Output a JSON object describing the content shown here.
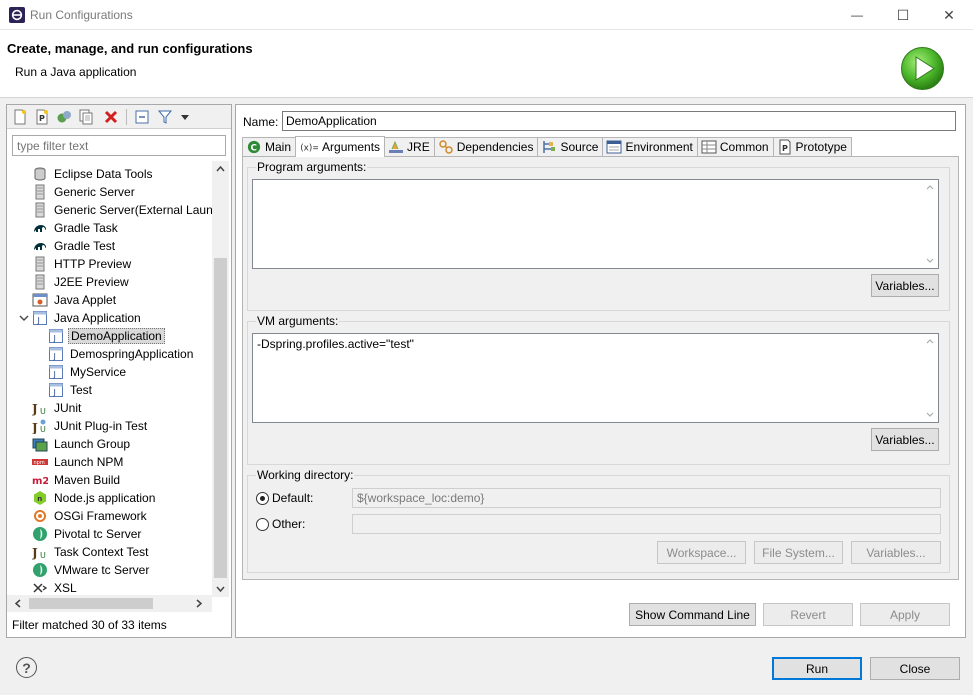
{
  "window": {
    "title": "Run Configurations",
    "controls": {
      "minimize": "—",
      "maximize": "☐",
      "close": "✕"
    }
  },
  "header": {
    "title": "Create, manage, and run configurations",
    "subtitle": "Run a Java application"
  },
  "left": {
    "filter_placeholder": "type filter text",
    "tree": [
      {
        "label": "Eclipse Data Tools",
        "icon": "database-icon",
        "depth": 0
      },
      {
        "label": "Generic Server",
        "icon": "server-icon",
        "depth": 0
      },
      {
        "label": "Generic Server(External Launch)",
        "icon": "server-icon",
        "depth": 0
      },
      {
        "label": "Gradle Task",
        "icon": "gradle-elephant-icon",
        "depth": 0
      },
      {
        "label": "Gradle Test",
        "icon": "gradle-elephant-icon",
        "depth": 0
      },
      {
        "label": "HTTP Preview",
        "icon": "server-icon",
        "depth": 0
      },
      {
        "label": "J2EE Preview",
        "icon": "server-icon",
        "depth": 0
      },
      {
        "label": "Java Applet",
        "icon": "applet-icon",
        "depth": 0
      },
      {
        "label": "Java Application",
        "icon": "java-app-icon",
        "depth": 0,
        "expanded": true
      },
      {
        "label": "DemoApplication",
        "icon": "java-app-icon",
        "depth": 1,
        "selected": true
      },
      {
        "label": "DemospringApplication",
        "icon": "java-app-icon",
        "depth": 1
      },
      {
        "label": "MyService",
        "icon": "java-app-icon",
        "depth": 1
      },
      {
        "label": "Test",
        "icon": "java-app-icon",
        "depth": 1
      },
      {
        "label": "JUnit",
        "icon": "junit-icon",
        "depth": 0
      },
      {
        "label": "JUnit Plug-in Test",
        "icon": "junit-plugin-icon",
        "depth": 0
      },
      {
        "label": "Launch Group",
        "icon": "launch-group-icon",
        "depth": 0
      },
      {
        "label": "Launch NPM",
        "icon": "npm-icon",
        "depth": 0
      },
      {
        "label": "Maven Build",
        "icon": "maven-icon",
        "depth": 0
      },
      {
        "label": "Node.js application",
        "icon": "nodejs-icon",
        "depth": 0
      },
      {
        "label": "OSGi Framework",
        "icon": "osgi-icon",
        "depth": 0
      },
      {
        "label": "Pivotal tc Server",
        "icon": "pivotal-icon",
        "depth": 0
      },
      {
        "label": "Task Context Test",
        "icon": "junit-icon",
        "depth": 0
      },
      {
        "label": "VMware tc Server",
        "icon": "pivotal-icon",
        "depth": 0
      },
      {
        "label": "XSL",
        "icon": "xsl-icon",
        "depth": 0
      }
    ],
    "filter_status": "Filter matched 30 of 33 items"
  },
  "right": {
    "name_label": "Name:",
    "name_value": "DemoApplication",
    "tabs": [
      {
        "label": "Main",
        "icon": "main-tab-icon"
      },
      {
        "label": "Arguments",
        "icon": "arguments-tab-icon",
        "active": true
      },
      {
        "label": "JRE",
        "icon": "jre-tab-icon"
      },
      {
        "label": "Dependencies",
        "icon": "dependencies-tab-icon"
      },
      {
        "label": "Source",
        "icon": "source-tab-icon"
      },
      {
        "label": "Environment",
        "icon": "environment-tab-icon"
      },
      {
        "label": "Common",
        "icon": "common-tab-icon"
      },
      {
        "label": "Prototype",
        "icon": "prototype-tab-icon"
      }
    ],
    "program_args": {
      "label": "Program arguments:",
      "value": "",
      "variables": "Variables..."
    },
    "vm_args": {
      "label": "VM arguments:",
      "value": "-Dspring.profiles.active=\"test\"",
      "variables": "Variables..."
    },
    "workdir": {
      "label": "Working directory:",
      "default_label": "Default:",
      "default_value": "${workspace_loc:demo}",
      "other_label": "Other:",
      "other_value": "",
      "workspace": "Workspace...",
      "filesystem": "File System...",
      "variables": "Variables..."
    },
    "show_command_line": "Show Command Line",
    "revert": "Revert",
    "apply": "Apply"
  },
  "footer": {
    "help": "?",
    "run": "Run",
    "close": "Close"
  }
}
